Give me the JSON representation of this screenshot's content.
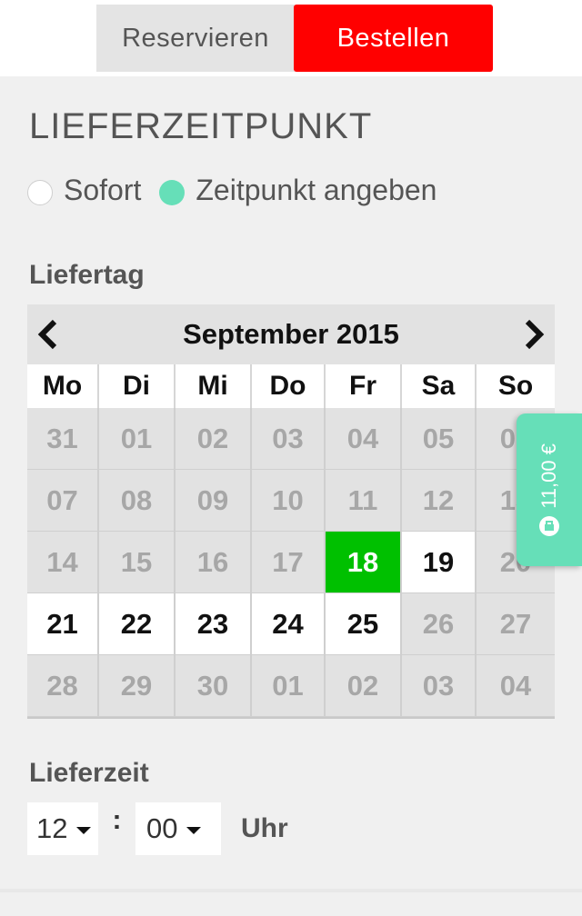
{
  "tabs": {
    "reserve_label": "Reservieren",
    "order_label": "Bestellen"
  },
  "delivery": {
    "title": "LIEFERZEITPUNKT",
    "option_now": "Sofort",
    "option_time": "Zeitpunkt angeben",
    "selected_option": "Zeitpunkt angeben"
  },
  "delivery_day": {
    "label": "Liefertag",
    "month_title": "September 2015",
    "weekdays": [
      "Mo",
      "Di",
      "Mi",
      "Do",
      "Fr",
      "Sa",
      "So"
    ],
    "weeks": [
      [
        {
          "d": "31",
          "s": "inactive"
        },
        {
          "d": "01",
          "s": "inactive"
        },
        {
          "d": "02",
          "s": "inactive"
        },
        {
          "d": "03",
          "s": "inactive"
        },
        {
          "d": "04",
          "s": "inactive"
        },
        {
          "d": "05",
          "s": "inactive"
        },
        {
          "d": "06",
          "s": "inactive"
        }
      ],
      [
        {
          "d": "07",
          "s": "inactive"
        },
        {
          "d": "08",
          "s": "inactive"
        },
        {
          "d": "09",
          "s": "inactive"
        },
        {
          "d": "10",
          "s": "inactive"
        },
        {
          "d": "11",
          "s": "inactive"
        },
        {
          "d": "12",
          "s": "inactive"
        },
        {
          "d": "13",
          "s": "inactive"
        }
      ],
      [
        {
          "d": "14",
          "s": "inactive"
        },
        {
          "d": "15",
          "s": "inactive"
        },
        {
          "d": "16",
          "s": "inactive"
        },
        {
          "d": "17",
          "s": "inactive"
        },
        {
          "d": "18",
          "s": "selected"
        },
        {
          "d": "19",
          "s": "available"
        },
        {
          "d": "20",
          "s": "inactive"
        }
      ],
      [
        {
          "d": "21",
          "s": "available"
        },
        {
          "d": "22",
          "s": "available"
        },
        {
          "d": "23",
          "s": "available"
        },
        {
          "d": "24",
          "s": "available"
        },
        {
          "d": "25",
          "s": "available"
        },
        {
          "d": "26",
          "s": "inactive"
        },
        {
          "d": "27",
          "s": "inactive"
        }
      ],
      [
        {
          "d": "28",
          "s": "inactive"
        },
        {
          "d": "29",
          "s": "inactive"
        },
        {
          "d": "30",
          "s": "inactive"
        },
        {
          "d": "01",
          "s": "inactive"
        },
        {
          "d": "02",
          "s": "inactive"
        },
        {
          "d": "03",
          "s": "inactive"
        },
        {
          "d": "04",
          "s": "inactive"
        }
      ]
    ]
  },
  "delivery_time": {
    "label": "Lieferzeit",
    "hour": "12",
    "separator": ":",
    "minute": "00",
    "unit": "Uhr"
  },
  "cart": {
    "amount": "11,00 €",
    "icon": "cart-icon"
  },
  "colors": {
    "accent_red": "#ff0000",
    "accent_mint": "#66dfb8",
    "selected_day": "#00c000"
  }
}
